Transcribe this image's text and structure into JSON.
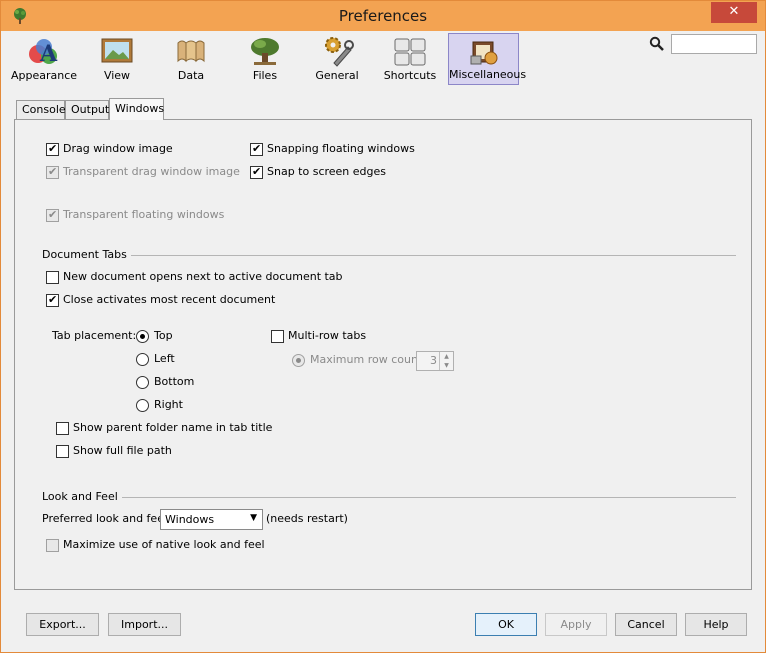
{
  "window": {
    "title": "Preferences",
    "close_glyph": "✕"
  },
  "toolbar": [
    {
      "label": "Appearance",
      "icon": "appearance-icon"
    },
    {
      "label": "View",
      "icon": "view-icon"
    },
    {
      "label": "Data",
      "icon": "data-icon"
    },
    {
      "label": "Files",
      "icon": "files-icon"
    },
    {
      "label": "General",
      "icon": "general-icon"
    },
    {
      "label": "Shortcuts",
      "icon": "shortcuts-icon"
    },
    {
      "label": "Miscellaneous",
      "icon": "miscellaneous-icon",
      "selected": true
    }
  ],
  "search": {
    "value": "",
    "placeholder": ""
  },
  "tabs": [
    {
      "label": "Console"
    },
    {
      "label": "Output"
    },
    {
      "label": "Windows",
      "selected": true
    }
  ],
  "windows_options": {
    "drag_window_image": {
      "label": "Drag window image",
      "checked": true,
      "enabled": true
    },
    "transparent_drag_window_image": {
      "label": "Transparent drag window image",
      "checked": true,
      "enabled": false
    },
    "snapping_floating_windows": {
      "label": "Snapping floating windows",
      "checked": true,
      "enabled": true
    },
    "snap_to_screen_edges": {
      "label": "Snap to screen edges",
      "checked": true,
      "enabled": true
    },
    "transparent_floating_windows": {
      "label": "Transparent floating windows",
      "checked": true,
      "enabled": false
    }
  },
  "document_tabs": {
    "section_title": "Document Tabs",
    "new_document_next": {
      "label": "New document opens next to active document tab",
      "checked": false
    },
    "close_activates_recent": {
      "label": "Close activates most recent document",
      "checked": true
    },
    "tab_placement_label": "Tab placement:",
    "tab_placement_options": [
      {
        "label": "Top",
        "selected": true
      },
      {
        "label": "Left",
        "selected": false
      },
      {
        "label": "Bottom",
        "selected": false
      },
      {
        "label": "Right",
        "selected": false
      }
    ],
    "multi_row_tabs": {
      "label": "Multi-row tabs",
      "checked": false
    },
    "maximum_row_count": {
      "label": "Maximum row count:",
      "value": "3",
      "selected": true,
      "enabled": false
    },
    "show_parent_folder": {
      "label": "Show parent folder name in tab title",
      "checked": false
    },
    "show_full_path": {
      "label": "Show full file path",
      "checked": false
    }
  },
  "look_and_feel": {
    "section_title": "Look and Feel",
    "preferred_label": "Preferred look and feel:",
    "preferred_value": "Windows",
    "restart_note": "(needs restart)",
    "maximize_native": {
      "label": "Maximize use of native look and feel",
      "checked": false,
      "enabled": false
    }
  },
  "buttons": {
    "export": "Export...",
    "import": "Import...",
    "ok": "OK",
    "apply": "Apply",
    "cancel": "Cancel",
    "help": "Help"
  },
  "colors": {
    "titlebar": "#f3a352",
    "close_button": "#c7493a",
    "selected_toolbar": "#d8d4f0"
  }
}
